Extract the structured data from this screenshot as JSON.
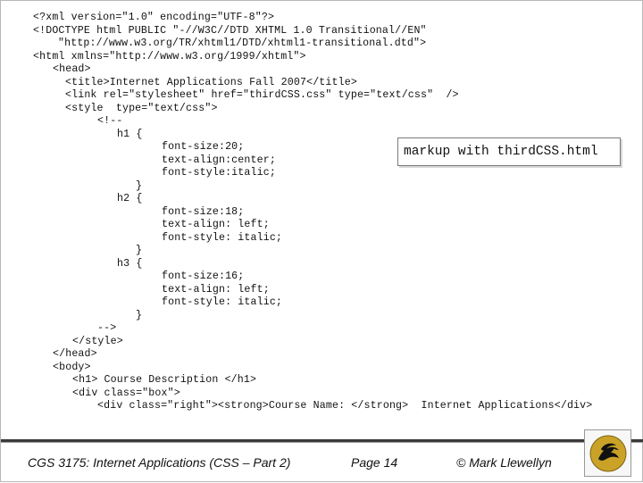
{
  "code": {
    "lines": [
      "<?xml version=\"1.0\" encoding=\"UTF-8\"?>",
      "<!DOCTYPE html PUBLIC \"-//W3C//DTD XHTML 1.0 Transitional//EN\"",
      "\"http://www.w3.org/TR/xhtml1/DTD/xhtml1-transitional.dtd\">",
      "<html xmlns=\"http://www.w3.org/1999/xhtml\">",
      "<head>",
      "<title>Internet Applications Fall 2007</title>",
      "<link rel=\"stylesheet\" href=\"thirdCSS.css\" type=\"text/css\"  />",
      "<style  type=\"text/css\">",
      "<!--",
      "h1 {",
      "font-size:20;",
      "text-align:center;",
      "font-style:italic;",
      "}",
      "h2 {",
      "font-size:18;",
      "text-align: left;",
      "font-style: italic;",
      "}",
      "h3 {",
      "font-size:16;",
      "text-align: left;",
      "font-style: italic;",
      "}",
      "-->",
      "</style>",
      "</head>",
      "<body>",
      "<h1> Course Description </h1>",
      "<div class=\"box\">",
      "<div class=\"right\"><strong>Course Name: </strong>  Internet Applications</div>"
    ]
  },
  "callout": {
    "text": "markup with thirdCSS.html"
  },
  "footer": {
    "course": "CGS 3175: Internet Applications (CSS – Part 2)",
    "page": "Page 14",
    "author": "© Mark Llewellyn"
  },
  "logo": {
    "name": "ucf-pegasus-logo",
    "colors": {
      "gold": "#c9a227",
      "black": "#111111"
    }
  }
}
